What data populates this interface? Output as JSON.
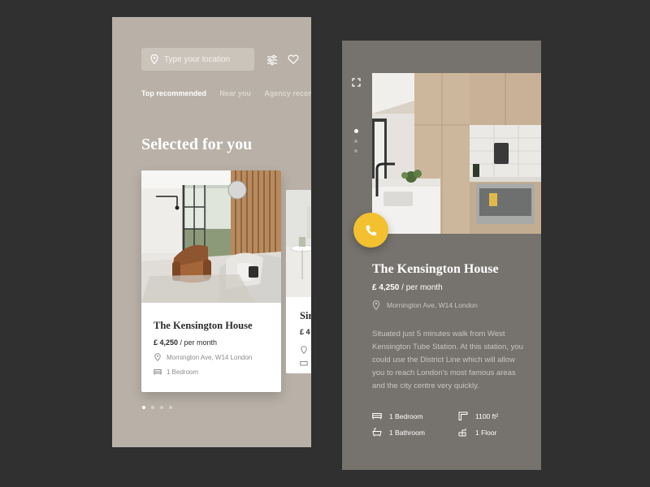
{
  "list_screen": {
    "search": {
      "placeholder": "Type your location",
      "value": ""
    },
    "icons": {
      "location": "location-pin-icon",
      "filter": "filter-sliders-icon",
      "favorite": "heart-icon"
    },
    "tabs": [
      {
        "label": "Top recommended",
        "active": true
      },
      {
        "label": "Near you",
        "active": false
      },
      {
        "label": "Agency recom",
        "active": false
      }
    ],
    "heading": "Selected for you",
    "cards": [
      {
        "title": "The Kensington House",
        "price": "£ 4,250",
        "price_suffix": " / per month",
        "location": "Mornington Ave, W14 London",
        "rooms": "1 Bedroom"
      },
      {
        "title": "Sir",
        "price": "£ 4"
      }
    ],
    "pagination": {
      "total": 4,
      "active": 1
    }
  },
  "detail_screen": {
    "title": "The Kensington House",
    "price": "£ 4,250",
    "price_suffix": " / per month",
    "location": "Mornington Ave, W14 London",
    "description": "Situated just 5 minutes walk from West Kensington Tube Station. At this station, you could use the District Line which will allow you to reach London's most famous areas and the city centre very quickly.",
    "specs": {
      "bedroom": "1 Bedroom",
      "area": "1100 ft²",
      "bathroom": "1 Bathroom",
      "floor": "1 Floor"
    },
    "gallery_pagination": {
      "total": 3,
      "active": 1
    },
    "call_button_color": "#f3c02f"
  },
  "colors": {
    "background": "#303030",
    "list_panel": "#b9b1a7",
    "detail_panel": "#76736e",
    "accent": "#f3c02f"
  }
}
